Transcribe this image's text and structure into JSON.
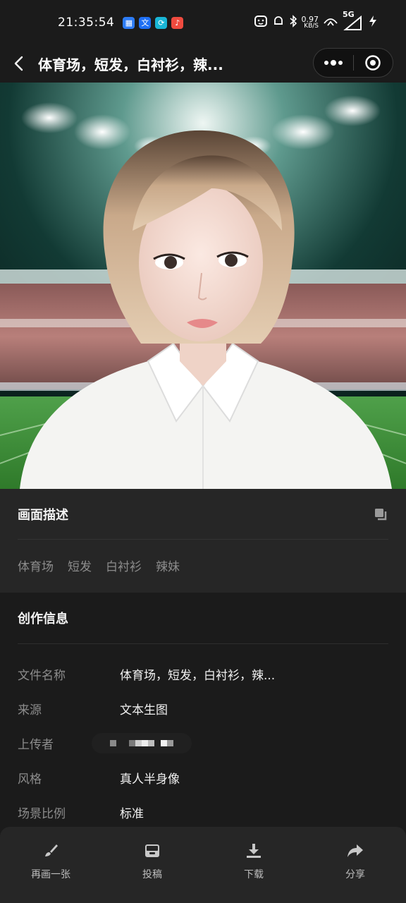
{
  "status_bar": {
    "time": "21:35:54",
    "net_speed_value": "0.97",
    "net_speed_unit": "KB/S",
    "network": "5G"
  },
  "nav": {
    "title": "体育场，短发，白衬衫，辣..."
  },
  "description": {
    "title": "画面描述",
    "tags": [
      "体育场",
      "短发",
      "白衬衫",
      "辣妹"
    ]
  },
  "info": {
    "title": "创作信息",
    "rows": [
      {
        "label": "文件名称",
        "value": "体育场，短发，白衬衫，辣..."
      },
      {
        "label": "来源",
        "value": "文本生图"
      },
      {
        "label": "上传者",
        "value": ""
      },
      {
        "label": "风格",
        "value": "真人半身像"
      },
      {
        "label": "场景比例",
        "value": "标准"
      }
    ]
  },
  "toolbar": {
    "items": [
      {
        "label": "再画一张",
        "icon": "brush-icon"
      },
      {
        "label": "投稿",
        "icon": "inbox-icon"
      },
      {
        "label": "下载",
        "icon": "download-icon"
      },
      {
        "label": "分享",
        "icon": "share-icon"
      }
    ]
  },
  "colors": {
    "background": "#1b1b1b",
    "card": "#262626",
    "muted_text": "#8c8c8c"
  }
}
